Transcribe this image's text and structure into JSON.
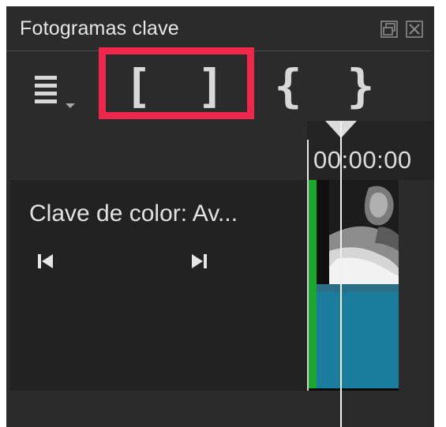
{
  "panel": {
    "title": "Fotogramas clave"
  },
  "toolbar": {
    "menu_icon": "menu-icon",
    "mark_in": "[",
    "mark_out": "]",
    "brace_open": "{",
    "brace_close": "}"
  },
  "timeline": {
    "timecode": "00:00:00"
  },
  "track": {
    "name": "Clave de color: Av..."
  },
  "colors": {
    "highlight": "#f0264d",
    "clip_green": "#1aa82a",
    "clip_blue": "#1a7d9e",
    "panel_bg": "#2b2b2b"
  }
}
